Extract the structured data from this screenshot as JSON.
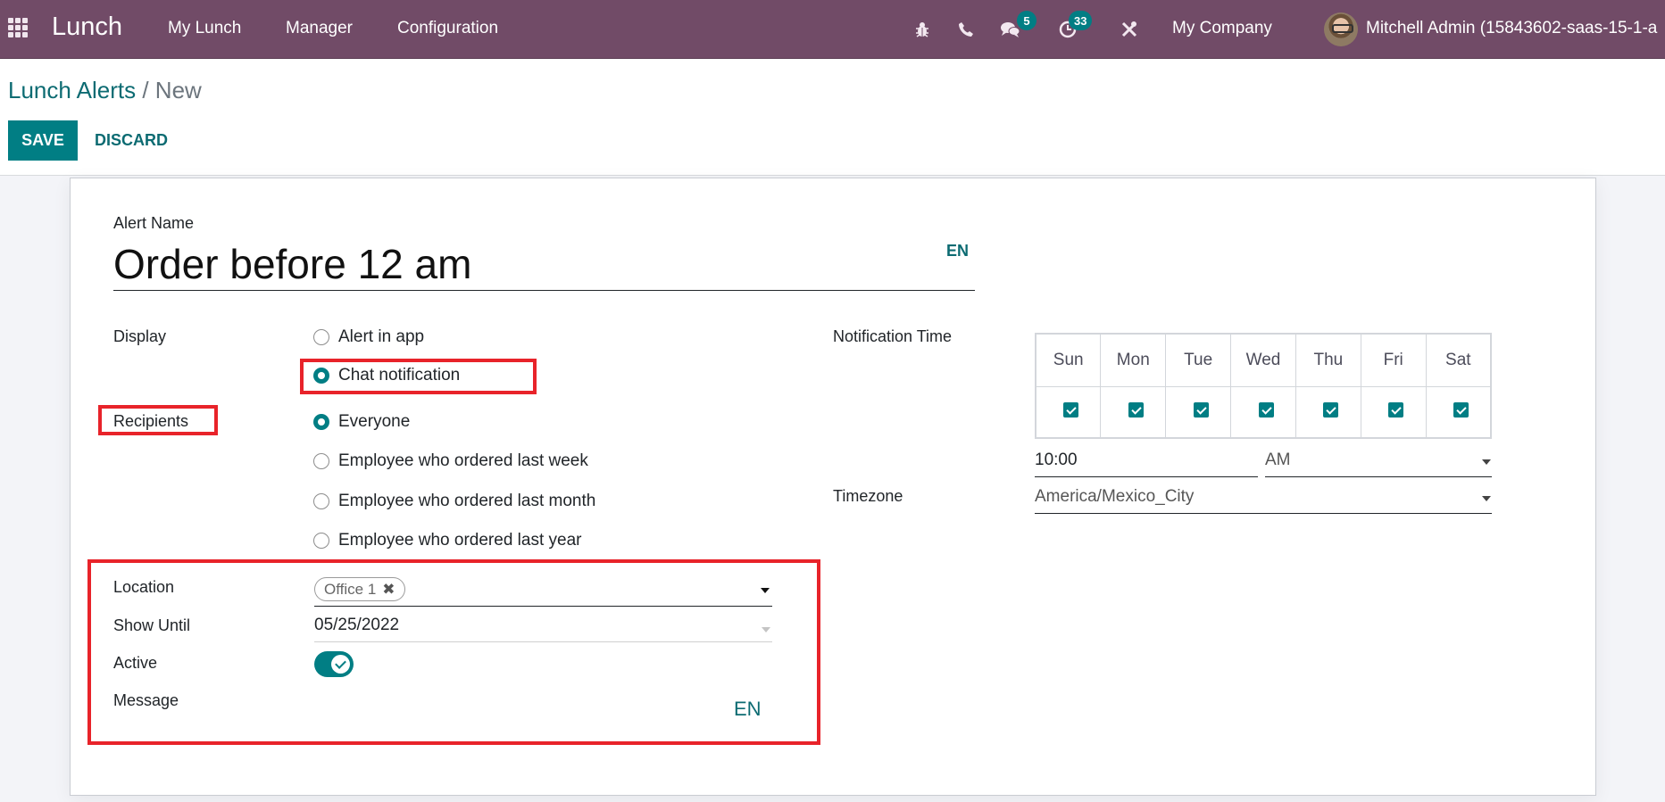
{
  "navbar": {
    "app_name": "Lunch",
    "menus": [
      "My Lunch",
      "Manager",
      "Configuration"
    ],
    "icons": [
      "bug-icon",
      "phone-icon",
      "chat-icon",
      "activity-clock-icon",
      "tools-icon"
    ],
    "messages_badge": "5",
    "activities_badge": "33",
    "company": "My Company",
    "user": "Mitchell Admin (15843602-saas-15-1-a"
  },
  "breadcrumb": {
    "parent": "Lunch Alerts",
    "separator": "/",
    "current": "New"
  },
  "toolbar": {
    "save_label": "SAVE",
    "discard_label": "DISCARD"
  },
  "form": {
    "alert_name_label": "Alert Name",
    "alert_name_value": "Order before 12 am",
    "lang_label": "EN",
    "display_label": "Display",
    "display_options": [
      {
        "label": "Alert in app",
        "checked": false
      },
      {
        "label": "Chat notification",
        "checked": true
      }
    ],
    "recipients_label": "Recipients",
    "recipients_options": [
      {
        "label": "Everyone",
        "checked": true
      },
      {
        "label": "Employee who ordered last week",
        "checked": false
      },
      {
        "label": "Employee who ordered last month",
        "checked": false
      },
      {
        "label": "Employee who ordered last year",
        "checked": false
      }
    ],
    "location_label": "Location",
    "location_tags": [
      "Office 1"
    ],
    "show_until_label": "Show Until",
    "show_until_value": "05/25/2022",
    "active_label": "Active",
    "active_value": true,
    "message_label": "Message",
    "message_lang": "EN",
    "notification_time_label": "Notification Time",
    "days": [
      {
        "label": "Sun",
        "checked": true
      },
      {
        "label": "Mon",
        "checked": true
      },
      {
        "label": "Tue",
        "checked": true
      },
      {
        "label": "Wed",
        "checked": true
      },
      {
        "label": "Thu",
        "checked": true
      },
      {
        "label": "Fri",
        "checked": true
      },
      {
        "label": "Sat",
        "checked": true
      }
    ],
    "time_value": "10:00",
    "ampm_value": "AM",
    "timezone_label": "Timezone",
    "timezone_value": "America/Mexico_City"
  },
  "colors": {
    "navbar": "#714B67",
    "primary": "#017e84",
    "highlight_box": "#e8232a"
  }
}
